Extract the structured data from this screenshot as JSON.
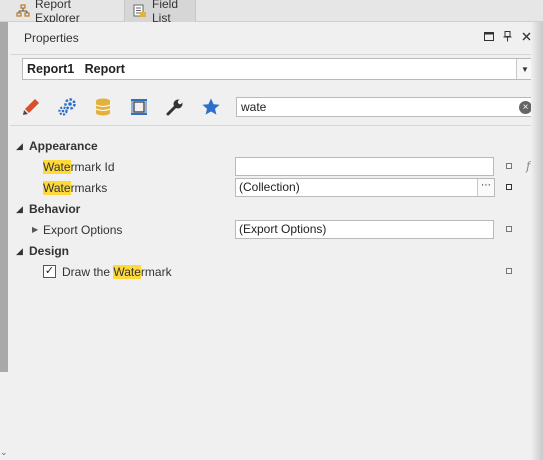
{
  "tabs": [
    {
      "label": "Report Explorer",
      "icon": "hierarchy-icon"
    },
    {
      "label": "Field List",
      "icon": "field-list-icon"
    }
  ],
  "panel": {
    "title": "Properties",
    "window_buttons": [
      "restore-icon",
      "pin-icon",
      "close-icon"
    ]
  },
  "object_selector": {
    "value": "Report1   Report"
  },
  "toolbar": {
    "icons": [
      "brush-icon",
      "gears-icon",
      "database-icon",
      "layout-icon",
      "wrench-icon",
      "star-icon"
    ]
  },
  "search": {
    "value": "wate"
  },
  "grid": {
    "categories": [
      {
        "label": "Appearance",
        "properties": [
          {
            "highlight": "Wate",
            "rest": "rmark Id",
            "value": ""
          },
          {
            "highlight": "Wate",
            "rest": "rmarks",
            "value": "(Collection)"
          }
        ]
      },
      {
        "label": "Behavior",
        "properties": [
          {
            "name": "Export Options",
            "value": "(Export Options)"
          }
        ]
      },
      {
        "label": "Design",
        "properties": [
          {
            "prefix": "Draw the ",
            "highlight": "Wate",
            "rest": "rmark",
            "checked": true
          }
        ]
      }
    ]
  },
  "colors": {
    "highlight": "#ffd83a",
    "toolbar_blue": "#2d6fc9",
    "toolbar_orange": "#e05a1a",
    "toolbar_gold": "#e3b23c"
  }
}
